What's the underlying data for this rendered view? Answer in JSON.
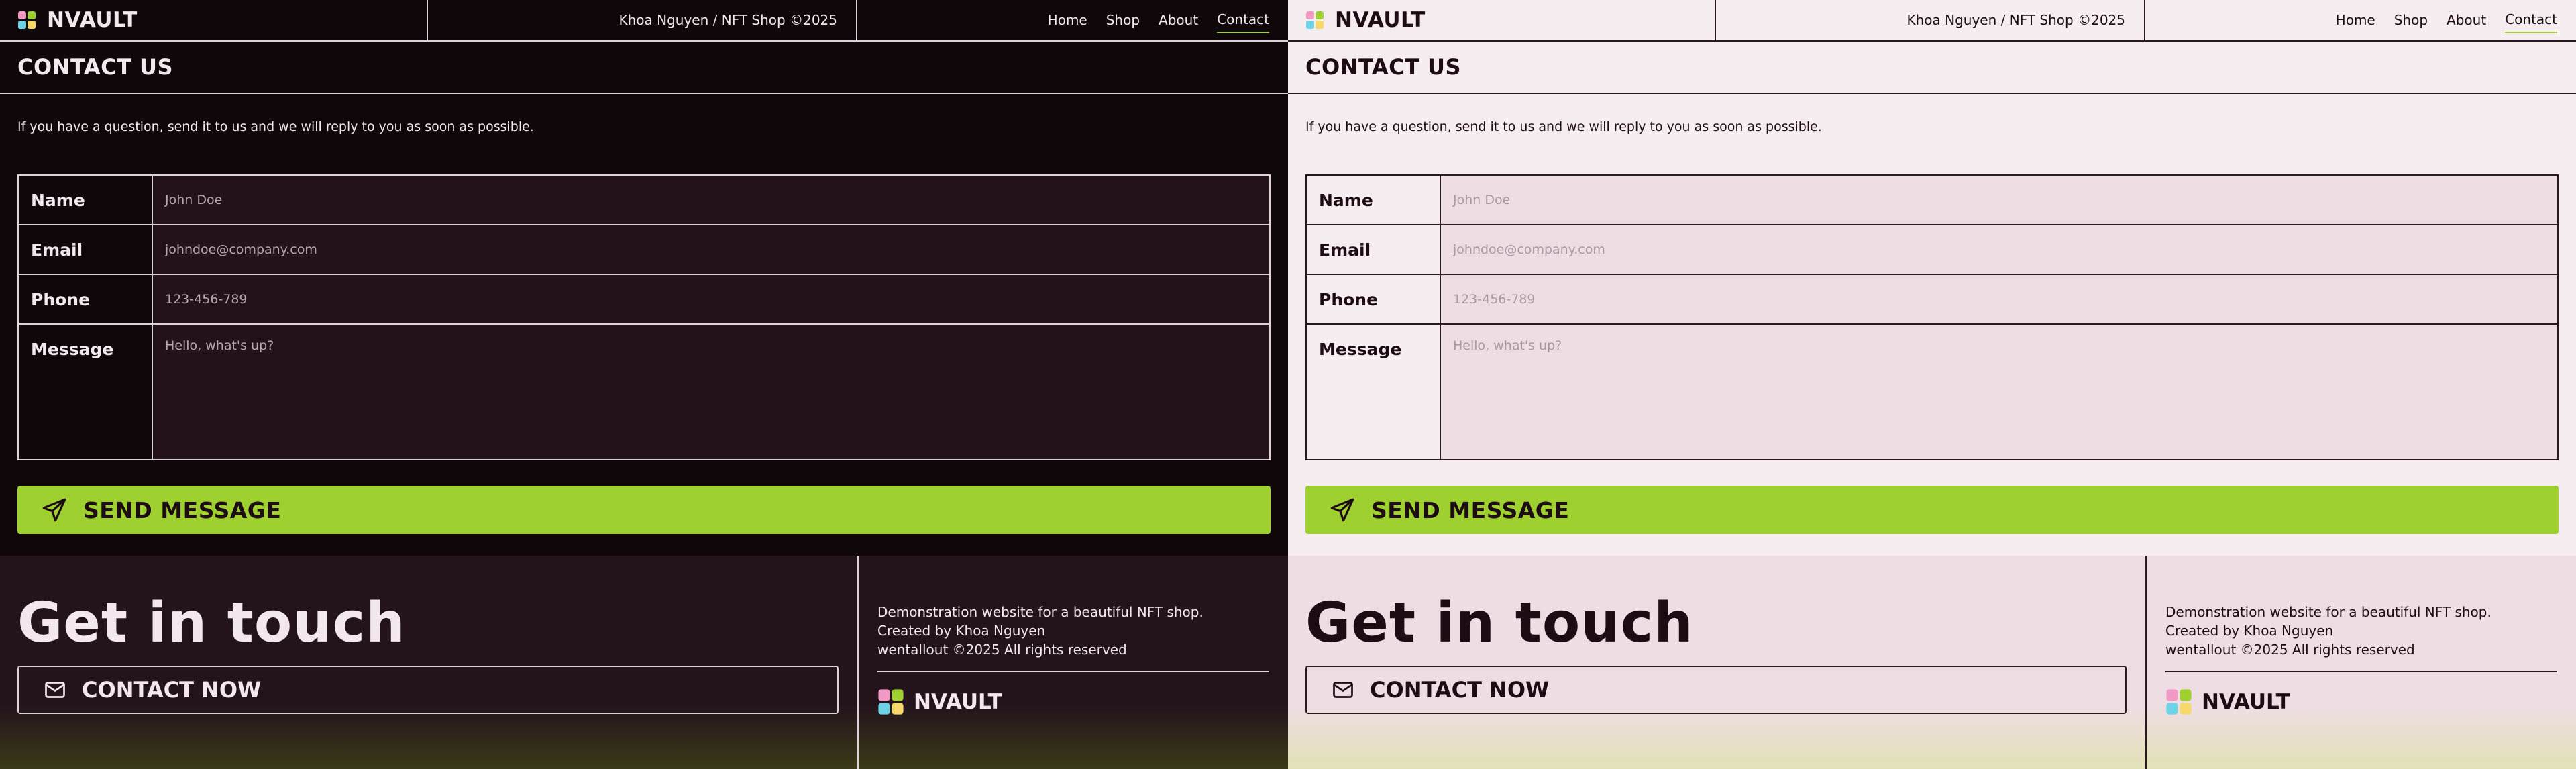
{
  "brand": {
    "name": "NVAULT"
  },
  "credit": "Khoa Nguyen / NFT Shop ©2025",
  "nav": [
    "Home",
    "Shop",
    "About",
    "Contact"
  ],
  "page": {
    "title": "CONTACT US",
    "intro": "If you have a question, send it to us and we will reply to you as soon as possible."
  },
  "form": {
    "name_label": "Name",
    "name_placeholder": "John Doe",
    "email_label": "Email",
    "email_placeholder": "johndoe@company.com",
    "phone_label": "Phone",
    "phone_placeholder": "123-456-789",
    "message_label": "Message",
    "message_placeholder": "Hello, what's up?",
    "send_label": "SEND MESSAGE"
  },
  "footer": {
    "heading": "Get in touch",
    "contact_label": "CONTACT NOW",
    "lines": [
      "Demonstration website for a beautiful NFT shop.",
      "Created by Khoa Nguyen",
      "wentallout ©2025 All rights reserved"
    ],
    "brand": "NVAULT"
  },
  "colors": {
    "accent": "#9ed12f",
    "dark_bg": "#0f070a",
    "light_bg": "#f6edf1"
  },
  "icons": [
    "nvault-logo-icon",
    "send-icon",
    "mail-icon"
  ]
}
